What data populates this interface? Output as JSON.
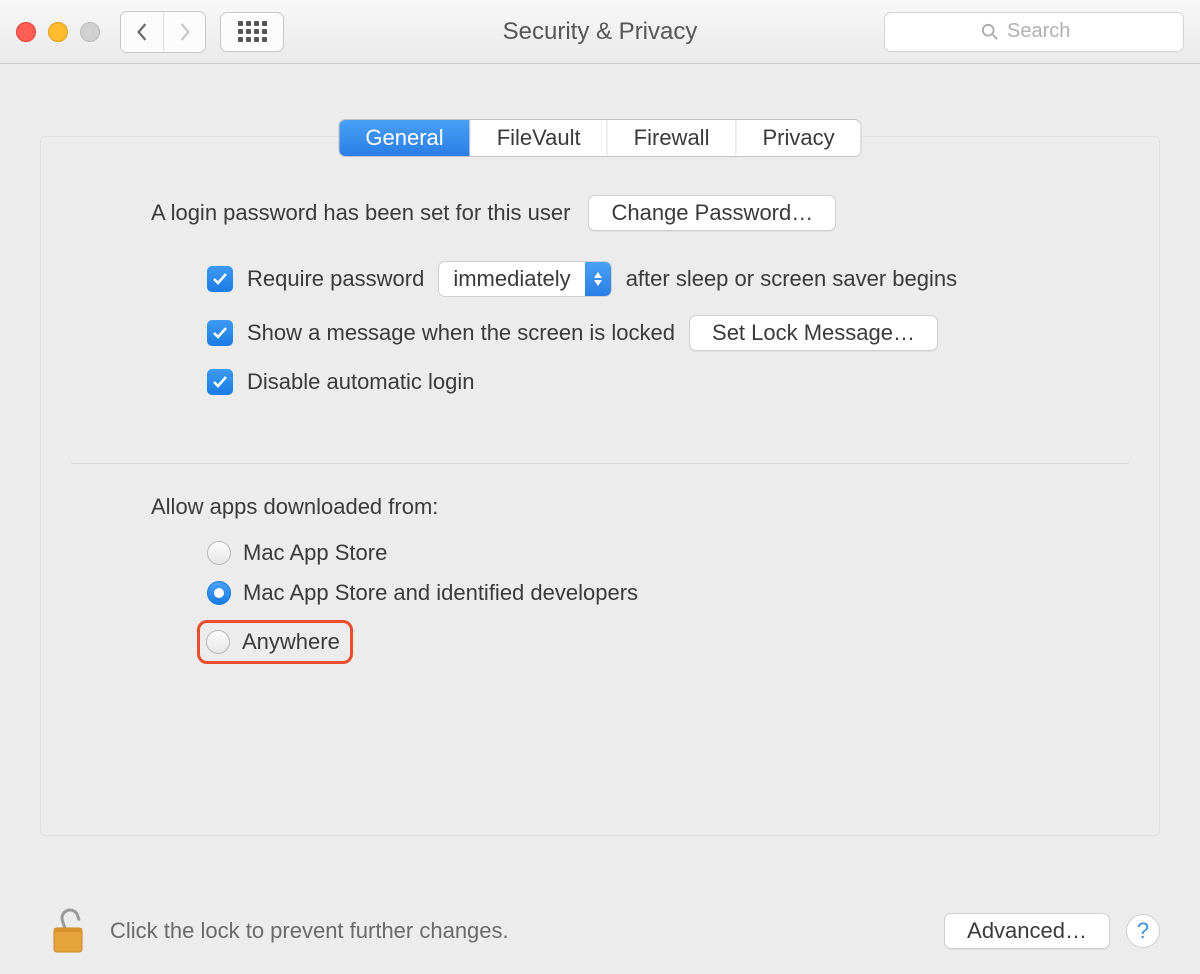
{
  "window": {
    "title": "Security & Privacy",
    "search_placeholder": "Search"
  },
  "tabs": {
    "general": "General",
    "filevault": "FileVault",
    "firewall": "Firewall",
    "privacy": "Privacy"
  },
  "general": {
    "login_password_text": "A login password has been set for this user",
    "change_password_label": "Change Password…",
    "require_password_label": "Require password",
    "require_password_after": "after sleep or screen saver begins",
    "require_password_delay": "immediately",
    "show_lock_message_label": "Show a message when the screen is locked",
    "set_lock_message_label": "Set Lock Message…",
    "disable_auto_login_label": "Disable automatic login",
    "allow_apps_from_label": "Allow apps downloaded from:",
    "radio": {
      "mas": "Mac App Store",
      "mas_identified": "Mac App Store and identified developers",
      "anywhere": "Anywhere"
    }
  },
  "footer": {
    "lock_text": "Click the lock to prevent further changes.",
    "advanced_label": "Advanced…",
    "help_label": "?"
  }
}
